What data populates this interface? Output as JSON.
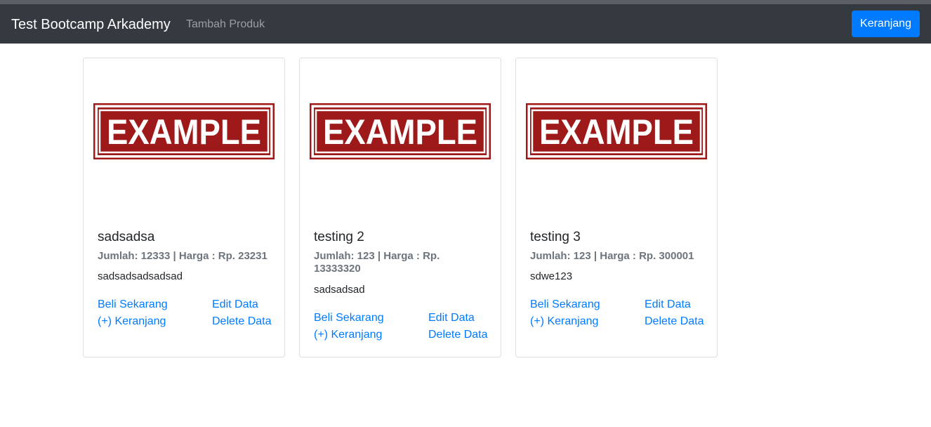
{
  "navbar": {
    "brand": "Test Bootcamp Arkademy",
    "add_product_link": "Tambah Produk",
    "cart_button": "Keranjang"
  },
  "image": {
    "stamp_text": "EXAMPLE",
    "stamp_color": "#9e1a1a"
  },
  "colors": {
    "navbar_bg": "#343a40",
    "primary": "#007bff",
    "muted": "#6c757d"
  },
  "products": [
    {
      "name": "sadsadsa",
      "meta": "Jumlah: 12333 | Harga : Rp. 23231",
      "description": "sadsadsadsadsad",
      "buy_label": "Beli Sekarang",
      "add_cart_label": "(+) Keranjang",
      "edit_label": "Edit Data",
      "delete_label": "Delete Data"
    },
    {
      "name": "testing 2",
      "meta": "Jumlah: 123 | Harga : Rp. 13333320",
      "description": "sadsadsad",
      "buy_label": "Beli Sekarang",
      "add_cart_label": "(+) Keranjang",
      "edit_label": "Edit Data",
      "delete_label": "Delete Data"
    },
    {
      "name": "testing 3",
      "meta": "Jumlah: 123 | Harga : Rp. 300001",
      "description": "sdwe123",
      "buy_label": "Beli Sekarang",
      "add_cart_label": "(+) Keranjang",
      "edit_label": "Edit Data",
      "delete_label": "Delete Data"
    }
  ]
}
